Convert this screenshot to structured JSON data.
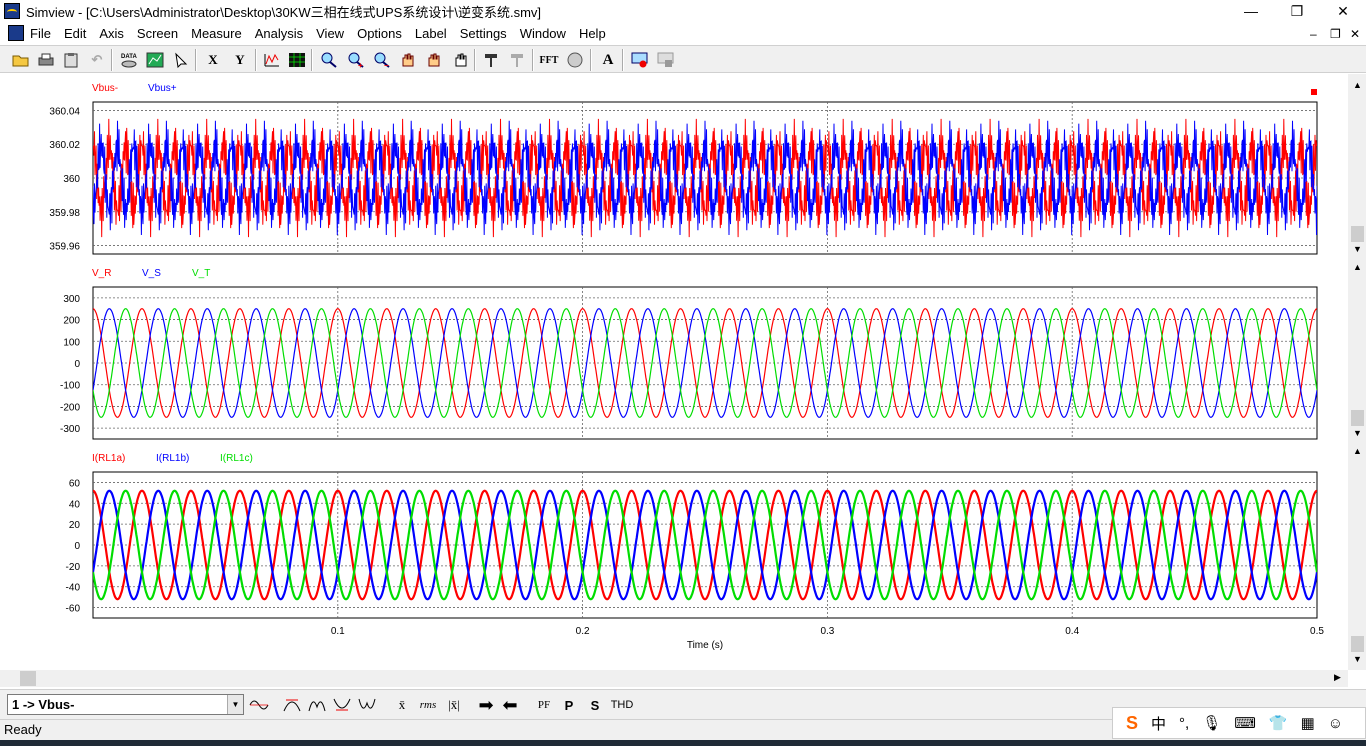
{
  "window": {
    "title": "Simview - [C:\\Users\\Administrator\\Desktop\\30KW三相在线式UPS系统设计\\逆变系统.smv]",
    "minimize": "—",
    "maximize": "❐",
    "close": "✕"
  },
  "menu": [
    "File",
    "Edit",
    "Axis",
    "Screen",
    "Measure",
    "Analysis",
    "View",
    "Options",
    "Label",
    "Settings",
    "Window",
    "Help"
  ],
  "toolbar": {
    "x_label": "X",
    "y_label": "Y",
    "fft_label": "FFT",
    "text_label": "A",
    "icons": [
      "open-icon",
      "print-icon",
      "clipboard-icon",
      "undo-icon",
      "data-icon",
      "chart-icon",
      "cursor-icon",
      "waveform-icon",
      "grid-icon",
      "zoom-icon",
      "zoom-in-icon",
      "zoom-out-icon",
      "pan-icon",
      "pan-2-icon",
      "hand-icon",
      "probe-icon",
      "probe-disabled-icon",
      "circle-icon",
      "record-icon",
      "stop-icon"
    ]
  },
  "colors": {
    "red": "#ff0000",
    "blue": "#0000ff",
    "green": "#00dd00"
  },
  "plots": [
    {
      "legend": [
        {
          "name": "Vbus-",
          "color": "#ff0000"
        },
        {
          "name": "Vbus+",
          "color": "#0000ff"
        }
      ],
      "yticks": [
        "360.04",
        "360.02",
        "360",
        "359.98",
        "359.96"
      ],
      "ylim": [
        359.955,
        360.045
      ]
    },
    {
      "legend": [
        {
          "name": "V_R",
          "color": "#ff0000"
        },
        {
          "name": "V_S",
          "color": "#0000ff"
        },
        {
          "name": "V_T",
          "color": "#00dd00"
        }
      ],
      "yticks": [
        "300",
        "200",
        "100",
        "0",
        "-100",
        "-200",
        "-300"
      ],
      "ylim": [
        -350,
        350
      ]
    },
    {
      "legend": [
        {
          "name": "I(RL1a)",
          "color": "#ff0000"
        },
        {
          "name": "I(RL1b)",
          "color": "#0000ff"
        },
        {
          "name": "I(RL1c)",
          "color": "#00dd00"
        }
      ],
      "yticks": [
        "60",
        "40",
        "20",
        "0",
        "-20",
        "-40",
        "-60"
      ],
      "ylim": [
        -70,
        70
      ]
    }
  ],
  "chart_data": {
    "type": "line",
    "xlabel": "Time (s)",
    "xticks": [
      "0.1",
      "0.2",
      "0.3",
      "0.4",
      "0.5"
    ],
    "xlim": [
      0,
      0.5
    ],
    "frequency_hz": 50,
    "series": [
      {
        "name": "Vbus-",
        "plot": 0,
        "mean": 360.0,
        "amplitude": 0.035
      },
      {
        "name": "Vbus+",
        "plot": 0,
        "mean": 360.0,
        "amplitude": 0.035
      },
      {
        "name": "V_R",
        "plot": 1,
        "amplitude": 250,
        "phase_deg": 90
      },
      {
        "name": "V_S",
        "plot": 1,
        "amplitude": 250,
        "phase_deg": -30
      },
      {
        "name": "V_T",
        "plot": 1,
        "amplitude": 250,
        "phase_deg": 210
      },
      {
        "name": "I(RL1a)",
        "plot": 2,
        "amplitude": 52,
        "phase_deg": 90
      },
      {
        "name": "I(RL1b)",
        "plot": 2,
        "amplitude": 52,
        "phase_deg": -30
      },
      {
        "name": "I(RL1c)",
        "plot": 2,
        "amplitude": 52,
        "phase_deg": 210
      }
    ]
  },
  "bottombar": {
    "selected_curve": "1 -> Vbus-",
    "rms_label": "rms",
    "pf_label": "PF",
    "p_label": "P",
    "s_label": "S",
    "thd_label": "THD"
  },
  "status": "Ready",
  "ime": {
    "logo": "S",
    "lang": "中",
    "punct": "°,"
  }
}
